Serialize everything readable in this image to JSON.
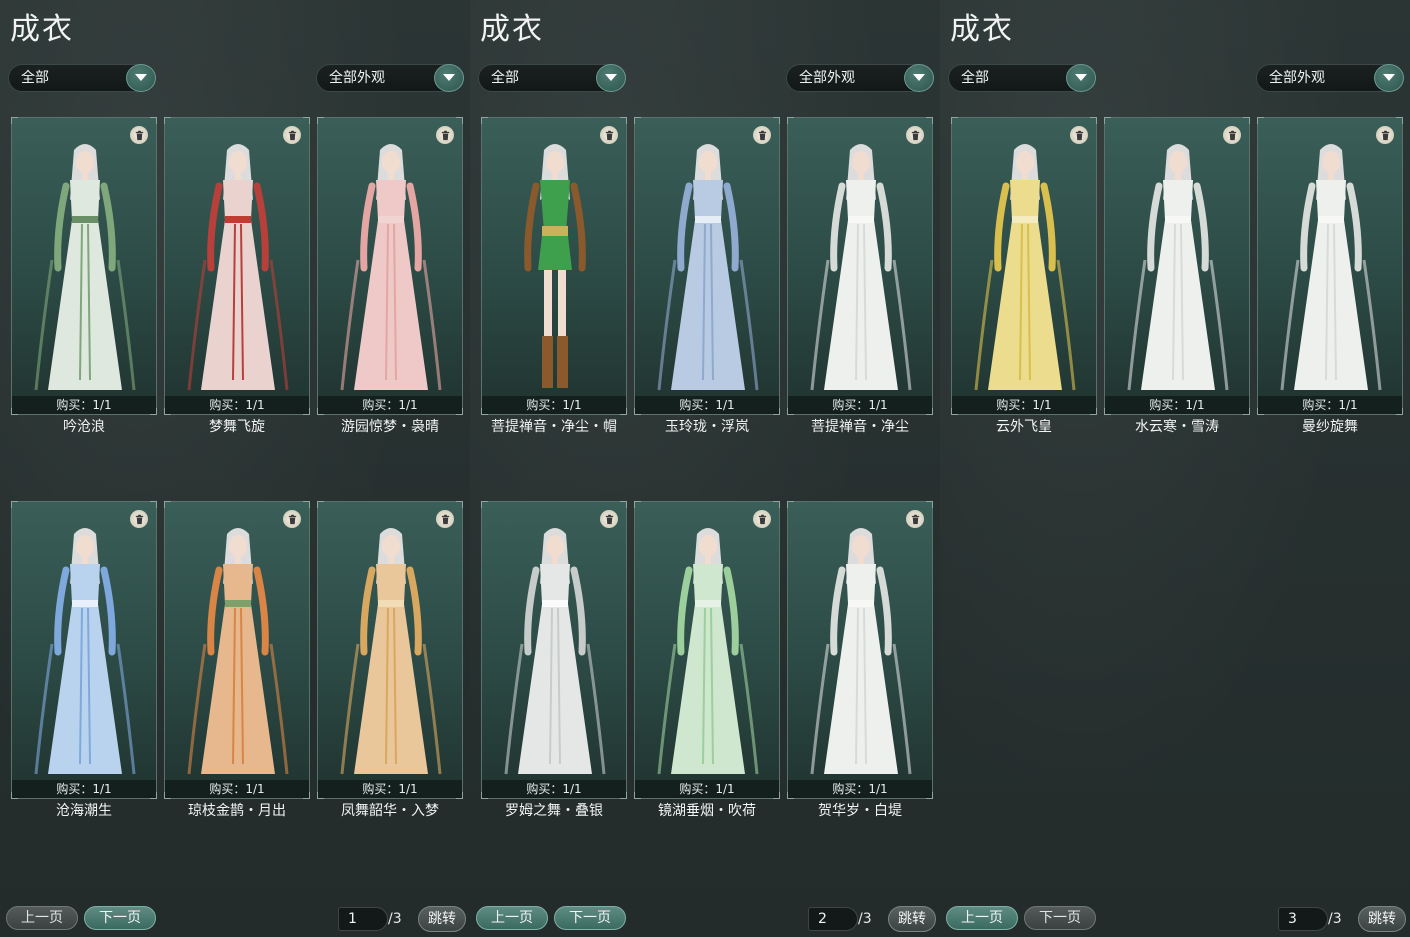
{
  "colors": {
    "card_bg": "#2c4a45",
    "accent": "#4f7c73",
    "background": "#25302f"
  },
  "panels": [
    {
      "title": "成衣",
      "filter1": "全部",
      "filter2": "全部外观",
      "items": [
        {
          "name": "吟沧浪",
          "buy": "购买：1/1",
          "palette": "green"
        },
        {
          "name": "梦舞飞旋",
          "buy": "购买：1/1",
          "palette": "pinkred"
        },
        {
          "name": "游园惊梦・袅晴",
          "buy": "购买：1/1",
          "palette": "pink"
        },
        {
          "name": "沧海潮生",
          "buy": "购买：1/1",
          "palette": "blue"
        },
        {
          "name": "琼枝金鹊・月出",
          "buy": "购买：1/1",
          "palette": "orange"
        },
        {
          "name": "凤舞韶华・入梦",
          "buy": "购买：1/1",
          "palette": "gold"
        }
      ],
      "prev_label": "上一页",
      "next_label": "下一页",
      "page_current": "1",
      "page_total": "/3",
      "jump_label": "跳转"
    },
    {
      "title": "成衣",
      "filter1": "全部",
      "filter2": "全部外观",
      "items": [
        {
          "name": "菩提禅音・净尘・帽",
          "buy": "购买：1/1",
          "palette": "greenshort"
        },
        {
          "name": "玉玲珑・浮岚",
          "buy": "购买：1/1",
          "palette": "lightblue"
        },
        {
          "name": "菩提禅音・净尘",
          "buy": "购买：1/1",
          "palette": "white"
        },
        {
          "name": "罗姆之舞・叠银",
          "buy": "购买：1/1",
          "palette": "silver"
        },
        {
          "name": "镜湖垂烟・吹荷",
          "buy": "购买：1/1",
          "palette": "mint"
        },
        {
          "name": "贺华岁・白堤",
          "buy": "购买：1/1",
          "palette": "white"
        }
      ],
      "prev_label": "上一页",
      "next_label": "下一页",
      "page_current": "2",
      "page_total": "/3",
      "jump_label": "跳转"
    },
    {
      "title": "成衣",
      "filter1": "全部",
      "filter2": "全部外观",
      "items": [
        {
          "name": "云外飞皇",
          "buy": "购买：1/1",
          "palette": "yellow"
        },
        {
          "name": "水云寒・雪涛",
          "buy": "购买：1/1",
          "palette": "white"
        },
        {
          "name": "曼纱旋舞",
          "buy": "购买：1/1",
          "palette": "white"
        }
      ],
      "prev_label": "上一页",
      "next_label": "下一页",
      "page_current": "3",
      "page_total": "/3",
      "jump_label": "跳转"
    }
  ]
}
